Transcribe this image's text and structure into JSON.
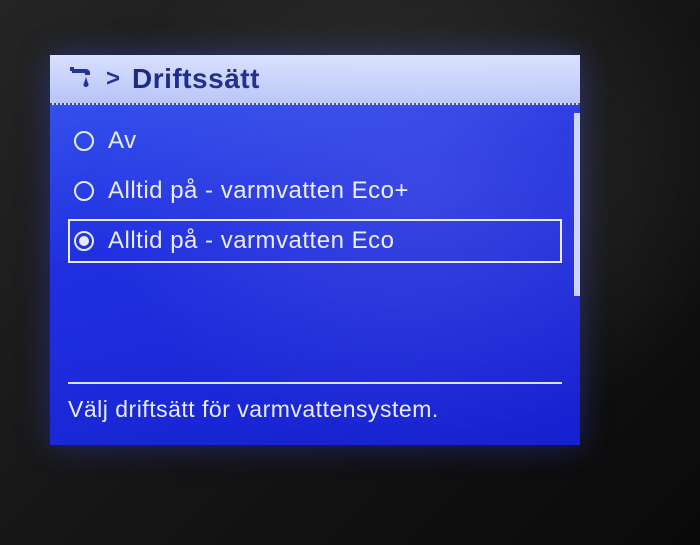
{
  "header": {
    "icon_name": "faucet-icon",
    "breadcrumb_chevron": ">",
    "title": "Driftssätt"
  },
  "options": [
    {
      "label": "Av",
      "selected": false
    },
    {
      "label": "Alltid på - varmvatten Eco+",
      "selected": false
    },
    {
      "label": "Alltid på - varmvatten Eco",
      "selected": true
    }
  ],
  "help_text": "Välj driftsätt för varmvattensystem."
}
